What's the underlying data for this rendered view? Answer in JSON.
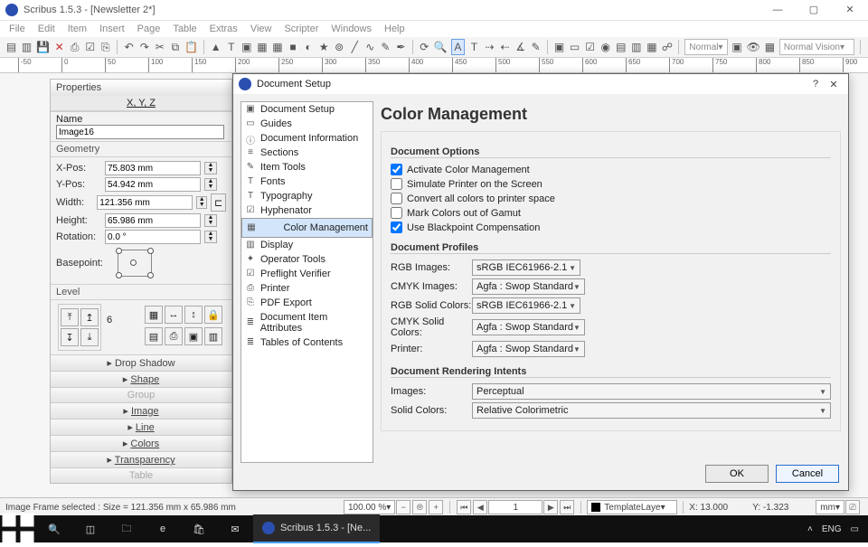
{
  "window": {
    "title": "Scribus 1.5.3 - [Newsletter 2*]"
  },
  "menu": [
    "File",
    "Edit",
    "Item",
    "Insert",
    "Page",
    "Table",
    "Extras",
    "View",
    "Scripter",
    "Windows",
    "Help"
  ],
  "toolbar_right": {
    "combo1": "Normal",
    "combo2": "Normal Vision"
  },
  "ruler_ticks": [
    "-50",
    "0",
    "50",
    "100",
    "150",
    "200",
    "250",
    "300",
    "350",
    "400",
    "450",
    "500",
    "550",
    "600",
    "650",
    "700",
    "750",
    "800",
    "850",
    "900"
  ],
  "properties": {
    "title": "Properties",
    "xyz": "X, Y, Z",
    "name_label": "Name",
    "name_value": "Image16",
    "geometry": "Geometry",
    "xpos_label": "X-Pos:",
    "xpos": "75.803 mm",
    "ypos_label": "Y-Pos:",
    "ypos": "54.942 mm",
    "width_label": "Width:",
    "width": "121.356 mm",
    "height_label": "Height:",
    "height": "65.986 mm",
    "rotation_label": "Rotation:",
    "rotation": "0.0 °",
    "basepoint_label": "Basepoint:",
    "level_label": "Level",
    "level_value": "6",
    "accordion": [
      "Drop Shadow",
      "Shape",
      "Group",
      "Image",
      "Line",
      "Colors",
      "Transparency",
      "Table"
    ]
  },
  "dialog": {
    "title": "Document Setup",
    "tree": [
      {
        "icon": "▣",
        "label": "Document Setup"
      },
      {
        "icon": "▭",
        "label": "Guides"
      },
      {
        "icon": "ⓘ",
        "label": "Document Information"
      },
      {
        "icon": "≡",
        "label": "Sections"
      },
      {
        "icon": "✎",
        "label": "Item Tools"
      },
      {
        "icon": "T",
        "label": "Fonts"
      },
      {
        "icon": "T",
        "label": "Typography"
      },
      {
        "icon": "☑",
        "label": "Hyphenator"
      },
      {
        "icon": "▦",
        "label": "Color Management"
      },
      {
        "icon": "▥",
        "label": "Display"
      },
      {
        "icon": "✦",
        "label": "Operator Tools"
      },
      {
        "icon": "☑",
        "label": "Preflight Verifier"
      },
      {
        "icon": "⎙",
        "label": "Printer"
      },
      {
        "icon": "⎘",
        "label": "PDF Export"
      },
      {
        "icon": "≣",
        "label": "Document Item Attributes"
      },
      {
        "icon": "≣",
        "label": "Tables of Contents"
      }
    ],
    "heading": "Color Management",
    "group1": "Document Options",
    "opts": [
      {
        "checked": true,
        "label": "Activate Color Management"
      },
      {
        "checked": false,
        "label": "Simulate Printer on the Screen"
      },
      {
        "checked": false,
        "label": "Convert all colors to printer space"
      },
      {
        "checked": false,
        "label": "Mark Colors out of Gamut"
      },
      {
        "checked": true,
        "label": "Use Blackpoint Compensation"
      }
    ],
    "group2": "Document Profiles",
    "profiles": [
      {
        "label": "RGB Images:",
        "value": "sRGB IEC61966-2.1"
      },
      {
        "label": "CMYK Images:",
        "value": "Agfa : Swop Standard"
      },
      {
        "label": "RGB Solid Colors:",
        "value": "sRGB IEC61966-2.1"
      },
      {
        "label": "CMYK Solid Colors:",
        "value": "Agfa : Swop Standard"
      },
      {
        "label": "Printer:",
        "value": "Agfa : Swop Standard"
      }
    ],
    "group3": "Document Rendering Intents",
    "intents": [
      {
        "label": "Images:",
        "value": "Perceptual"
      },
      {
        "label": "Solid Colors:",
        "value": "Relative Colorimetric"
      }
    ],
    "ok": "OK",
    "cancel": "Cancel"
  },
  "status": {
    "left": "Image Frame selected : Size = 121.356 mm x 65.986 mm",
    "zoom": "100.00 %",
    "page": "1",
    "layer": "TemplateLaye",
    "x": "X: 13.000",
    "y": "Y:    -1.323",
    "unit": "mm",
    "lang": "ENG"
  },
  "taskbar": {
    "app": "Scribus 1.5.3 - [Ne..."
  }
}
